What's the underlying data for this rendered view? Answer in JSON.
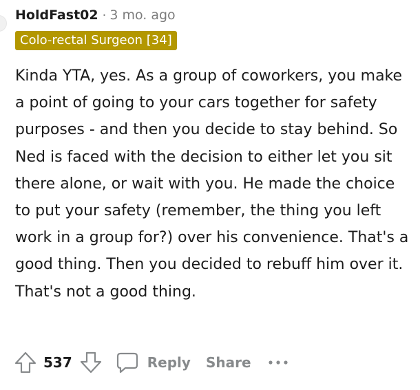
{
  "comment": {
    "author": "HoldFast02",
    "separator": "·",
    "timestamp": "3 mo. ago",
    "flair": "Colo-rectal Surgeon [34]",
    "body": "Kinda YTA, yes. As a group of coworkers, you make a point of going to your cars together for safety purposes - and then you decide to stay behind. So Ned is faced with the decision to either let you sit there alone, or wait with you. He made the choice to put your safety (remember, the thing you left work in a group for?) over his convenience. That's a good thing. Then you decided to rebuff him over it. That's not a good thing.",
    "score": "537",
    "actions": {
      "reply_label": "Reply",
      "share_label": "Share"
    },
    "colors": {
      "flair_background": "#b39700",
      "flair_text": "#ffffff",
      "meta_text": "#7c7c7c",
      "action_text": "#878a8c",
      "body_text": "#1c1c1c"
    },
    "icons": {
      "upvote": "upvote-arrow-icon",
      "downvote": "downvote-arrow-icon",
      "reply": "comment-bubble-icon",
      "more": "more-options-icon"
    }
  }
}
